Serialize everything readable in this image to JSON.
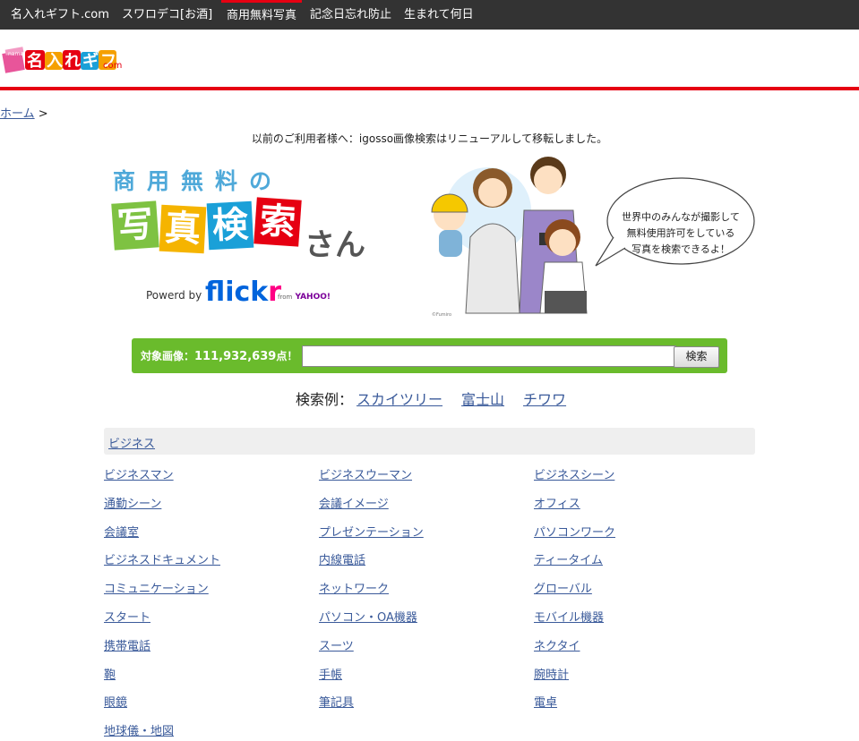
{
  "nav": [
    "名入れギフト.com",
    "スワロデコ[お酒]",
    "商用無料写真",
    "記念日忘れ防止",
    "生まれて何日"
  ],
  "logo": {
    "text": "名入れギフト",
    "suffix": "com"
  },
  "breadcrumb": {
    "home": "ホーム",
    "sep": ">"
  },
  "notice": "以前のご利用者様へ：igosso画像検索はリニューアルして移転しました。",
  "hero": {
    "title": "商用無料の",
    "tiles": [
      "写",
      "真",
      "検",
      "索"
    ],
    "san": "さん",
    "powered": "Powerd by",
    "flickr_a": "flick",
    "flickr_b": "r",
    "yahoo_from": "from",
    "yahoo": "YAHOO!",
    "bubble": [
      "世界中のみんなが撮影して",
      "無料使用許可をしている",
      "写真を検索できるよ！"
    ]
  },
  "search": {
    "label": "対象画像：",
    "count": "111,932,639",
    "suffix": "点！",
    "value": "",
    "button": "検索"
  },
  "examples": {
    "label": "検索例：",
    "links": [
      "スカイツリー",
      "富士山",
      "チワワ"
    ]
  },
  "category": {
    "title": "ビジネス",
    "items": [
      "ビジネスマン",
      "ビジネスウーマン",
      "ビジネスシーン",
      "通勤シーン",
      "会議イメージ",
      "オフィス",
      "会議室",
      "プレゼンテーション",
      "パソコンワーク",
      "ビジネスドキュメント",
      "内線電話",
      "ティータイム",
      "コミュニケーション",
      "ネットワーク",
      "グローバル",
      "スタート",
      "パソコン・OA機器",
      "モバイル機器",
      "携帯電話",
      "スーツ",
      "ネクタイ",
      "鞄",
      "手帳",
      "腕時計",
      "眼鏡",
      "筆記具",
      "電卓",
      "地球儀・地図"
    ]
  },
  "colors": {
    "accent_red": "#e60012",
    "search_green": "#6abb2c",
    "link": "#3a5a9a",
    "nav_bg": "#333333"
  }
}
